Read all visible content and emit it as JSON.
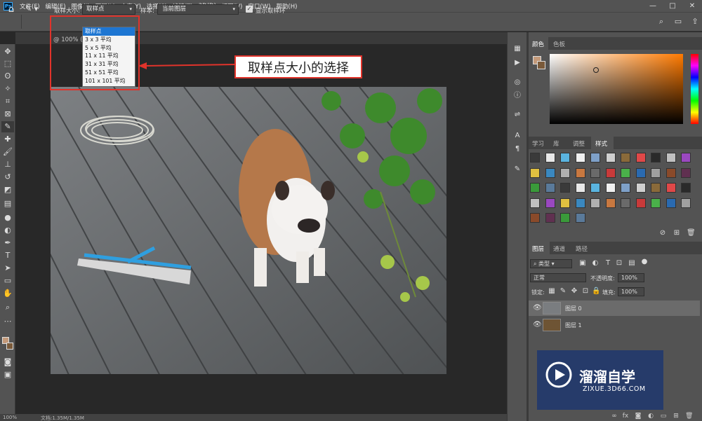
{
  "app": {
    "logo": "Ps"
  },
  "menubar": {
    "items": [
      "文件(F)",
      "编辑(E)",
      "图像(I)",
      "图层(L)",
      "文字(Y)",
      "选择(S)",
      "滤镜(T)",
      "3D(D)",
      "视图(V)",
      "窗口(W)",
      "帮助(H)"
    ],
    "minimize": "—",
    "maximize": "□",
    "close": "✕"
  },
  "options": {
    "sample_size_label": "取样大小:",
    "sample_size_value": "取样点",
    "sample_label": "样本:",
    "sample_value": "当前图层",
    "show_ring_label": "显示取样环"
  },
  "dropdown": {
    "options": [
      "取样点",
      "3 x 3 平均",
      "5 x 5 平均",
      "11 x 11 平均",
      "31 x 31 平均",
      "51 x 51 平均",
      "101 x 101 平均"
    ],
    "selected_index": 0
  },
  "document": {
    "tab_label": "@ 100% (图"
  },
  "annotation": {
    "text": "取样点大小的选择"
  },
  "status": {
    "zoom": "100%",
    "doc_info": "文档:1.35M/1.35M"
  },
  "color_panel": {
    "tabs": [
      "颜色",
      "色板"
    ]
  },
  "styles_panel": {
    "tabs": [
      "学习",
      "库",
      "调整",
      "样式"
    ]
  },
  "layers_panel": {
    "tabs": [
      "图层",
      "通道",
      "路径"
    ],
    "filter_kind": "类型",
    "blend_mode": "正常",
    "opacity_label": "不透明度:",
    "opacity_value": "100%",
    "lock_label": "锁定:",
    "fill_label": "填充:",
    "fill_value": "100%",
    "layers": [
      {
        "name": "图层 0",
        "selected": true
      },
      {
        "name": "图层 1",
        "selected": false
      }
    ]
  },
  "watermark": {
    "brand": "溜溜自学",
    "url": "ZIXUE.3D66.COM"
  },
  "colors": {
    "accent_red": "#e0332b",
    "selection_blue": "#1e76d2",
    "foreground": "#c49a7a",
    "background": "#7a5a3a"
  }
}
